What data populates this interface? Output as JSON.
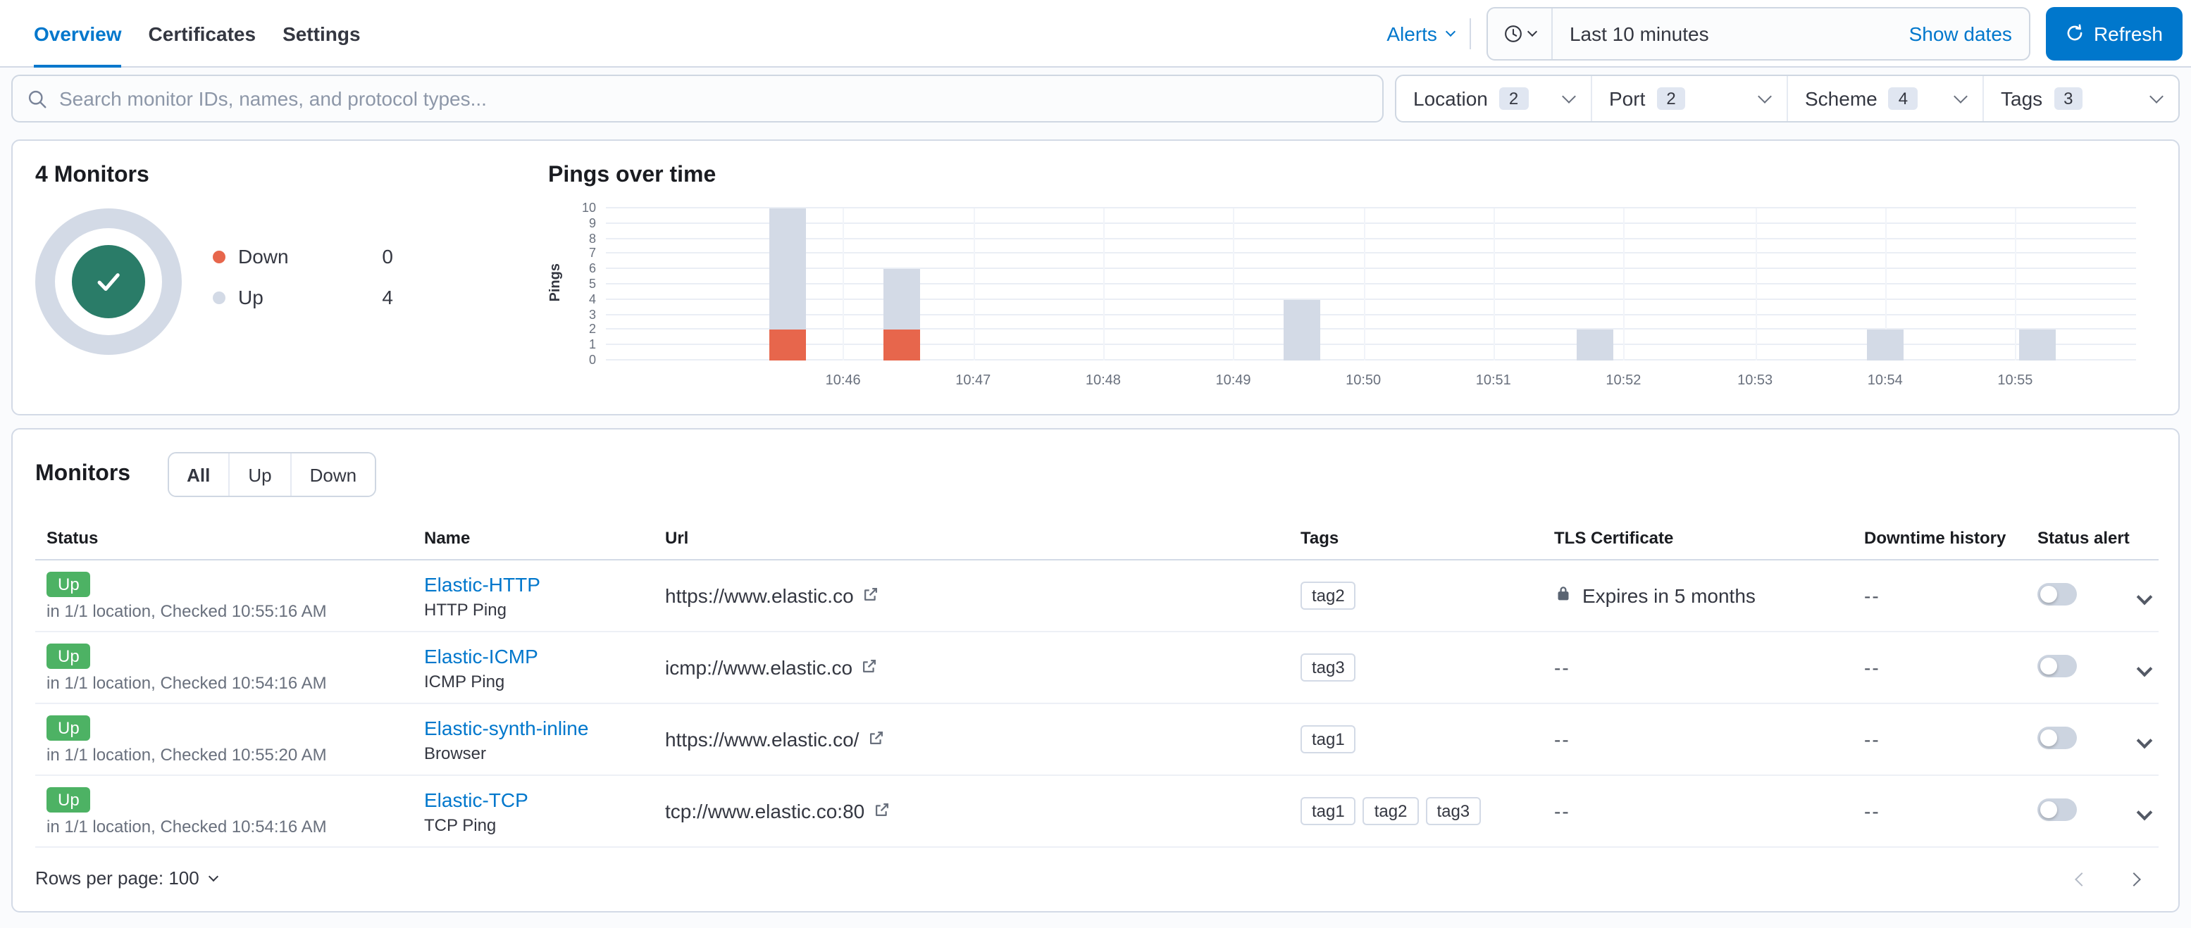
{
  "colors": {
    "primary": "#0077cc",
    "success_badge": "#4db264",
    "donut_center": "#2a7c68",
    "up": "#d3dae6",
    "down": "#e7664c"
  },
  "tabs": [
    {
      "label": "Overview",
      "active": true
    },
    {
      "label": "Certificates",
      "active": false
    },
    {
      "label": "Settings",
      "active": false
    }
  ],
  "topbar": {
    "alerts_label": "Alerts",
    "time_range": "Last 10 minutes",
    "show_dates_label": "Show dates",
    "refresh_label": "Refresh"
  },
  "search": {
    "placeholder": "Search monitor IDs, names, and protocol types..."
  },
  "filters": [
    {
      "label": "Location",
      "count": "2"
    },
    {
      "label": "Port",
      "count": "2"
    },
    {
      "label": "Scheme",
      "count": "4"
    },
    {
      "label": "Tags",
      "count": "3"
    }
  ],
  "summary": {
    "title": "4 Monitors",
    "legend": [
      {
        "label": "Down",
        "value": "0",
        "color": "#e7664c"
      },
      {
        "label": "Up",
        "value": "4",
        "color": "#d3dae6"
      }
    ]
  },
  "chart_data": {
    "type": "bar",
    "title": "Pings over time",
    "ylabel": "Pings",
    "ylim": [
      0,
      10
    ],
    "yticks": [
      0,
      1,
      2,
      3,
      4,
      5,
      6,
      7,
      8,
      9,
      10
    ],
    "xticks": [
      {
        "label": "10:46",
        "pct": 15.5
      },
      {
        "label": "10:47",
        "pct": 24.0
      },
      {
        "label": "10:48",
        "pct": 32.5
      },
      {
        "label": "10:49",
        "pct": 41.0
      },
      {
        "label": "10:50",
        "pct": 49.5
      },
      {
        "label": "10:51",
        "pct": 58.0
      },
      {
        "label": "10:52",
        "pct": 66.5
      },
      {
        "label": "10:53",
        "pct": 75.1
      },
      {
        "label": "10:54",
        "pct": 83.6
      },
      {
        "label": "10:55",
        "pct": 92.1
      }
    ],
    "series": [
      {
        "name": "Up",
        "color": "#d3dae6"
      },
      {
        "name": "Down",
        "color": "#e7664c"
      }
    ],
    "bars": [
      {
        "time": "10:45:30",
        "up": 8,
        "down": 2,
        "x_pct": 11.9
      },
      {
        "time": "10:46:30",
        "up": 4,
        "down": 2,
        "x_pct": 19.3
      },
      {
        "time": "10:49:30",
        "up": 4,
        "down": 0,
        "x_pct": 45.5
      },
      {
        "time": "10:52:00",
        "up": 2,
        "down": 0,
        "x_pct": 64.6
      },
      {
        "time": "10:54:00",
        "up": 2,
        "down": 0,
        "x_pct": 83.6
      },
      {
        "time": "10:55:00",
        "up": 2,
        "down": 0,
        "x_pct": 93.6
      }
    ]
  },
  "monitors": {
    "title": "Monitors",
    "status_filters": [
      {
        "label": "All",
        "selected": true
      },
      {
        "label": "Up",
        "selected": false
      },
      {
        "label": "Down",
        "selected": false
      }
    ],
    "columns": [
      "Status",
      "Name",
      "Url",
      "Tags",
      "TLS Certificate",
      "Downtime history",
      "Status alert",
      ""
    ],
    "rows": [
      {
        "status": "Up",
        "status_detail": "in 1/1 location, Checked 10:55:16 AM",
        "name": "Elastic-HTTP",
        "type": "HTTP Ping",
        "url": "https://www.elastic.co",
        "tags": [
          "tag2"
        ],
        "tls": "Expires in 5 months",
        "tls_has_lock": true,
        "downtime": "--",
        "alert_enabled": false
      },
      {
        "status": "Up",
        "status_detail": "in 1/1 location, Checked 10:54:16 AM",
        "name": "Elastic-ICMP",
        "type": "ICMP Ping",
        "url": "icmp://www.elastic.co",
        "tags": [
          "tag3"
        ],
        "tls": "--",
        "tls_has_lock": false,
        "downtime": "--",
        "alert_enabled": false
      },
      {
        "status": "Up",
        "status_detail": "in 1/1 location, Checked 10:55:20 AM",
        "name": "Elastic-synth-inline",
        "type": "Browser",
        "url": "https://www.elastic.co/",
        "tags": [
          "tag1"
        ],
        "tls": "--",
        "tls_has_lock": false,
        "downtime": "--",
        "alert_enabled": false
      },
      {
        "status": "Up",
        "status_detail": "in 1/1 location, Checked 10:54:16 AM",
        "name": "Elastic-TCP",
        "type": "TCP Ping",
        "url": "tcp://www.elastic.co:80",
        "tags": [
          "tag1",
          "tag2",
          "tag3"
        ],
        "tls": "--",
        "tls_has_lock": false,
        "downtime": "--",
        "alert_enabled": false
      }
    ],
    "rows_per_page_label": "Rows per page: 100"
  }
}
